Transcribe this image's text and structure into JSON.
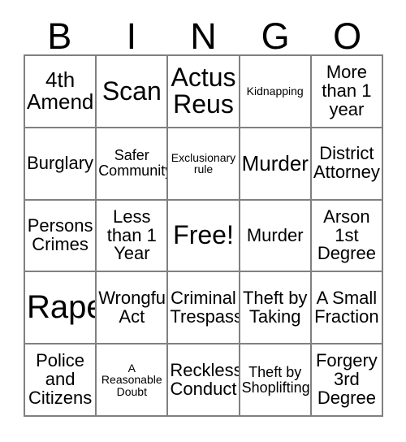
{
  "card": {
    "title": "BINGO",
    "header_letters": [
      "B",
      "I",
      "N",
      "G",
      "O"
    ],
    "free_space_label": "Free!",
    "colors": {
      "background": "#ffffff",
      "text": "#000000",
      "grid_line": "#808080"
    },
    "grid": {
      "columns": 5,
      "rows": 5,
      "cells": [
        [
          {
            "label": "4th Amend",
            "size": "lg",
            "free": false
          },
          {
            "label": "Scan",
            "size": "xl",
            "free": false
          },
          {
            "label": "Actus Reus",
            "size": "xl",
            "free": false
          },
          {
            "label": "Kidnapping",
            "size": "xs",
            "free": false
          },
          {
            "label": "More than 1 year",
            "size": "md",
            "free": false
          }
        ],
        [
          {
            "label": "Burglary",
            "size": "md",
            "free": false
          },
          {
            "label": "Safer Community",
            "size": "sm",
            "free": false
          },
          {
            "label": "Exclusionary rule",
            "size": "xs",
            "free": false
          },
          {
            "label": "Murder",
            "size": "lg",
            "free": false
          },
          {
            "label": "District Attorney",
            "size": "md",
            "free": false
          }
        ],
        [
          {
            "label": "Persons Crimes",
            "size": "md",
            "free": false
          },
          {
            "label": "Less than 1 Year",
            "size": "md",
            "free": false
          },
          {
            "label": "Free!",
            "size": "xl",
            "free": true
          },
          {
            "label": "Murder",
            "size": "md",
            "free": false
          },
          {
            "label": "Arson 1st Degree",
            "size": "md",
            "free": false
          }
        ],
        [
          {
            "label": "Rape",
            "size": "xxl",
            "free": false
          },
          {
            "label": "Wrongful Act",
            "size": "md",
            "free": false
          },
          {
            "label": "Criminal Trespass",
            "size": "md",
            "free": false
          },
          {
            "label": "Theft by Taking",
            "size": "md",
            "free": false
          },
          {
            "label": "A Small Fraction",
            "size": "md",
            "free": false
          }
        ],
        [
          {
            "label": "Police and Citizens",
            "size": "md",
            "free": false
          },
          {
            "label": "A Reasonable Doubt",
            "size": "xs",
            "free": false
          },
          {
            "label": "Reckless Conduct",
            "size": "md",
            "free": false
          },
          {
            "label": "Theft by Shoplifting",
            "size": "sm",
            "free": false
          },
          {
            "label": "Forgery 3rd Degree",
            "size": "md",
            "free": false
          }
        ]
      ]
    }
  }
}
